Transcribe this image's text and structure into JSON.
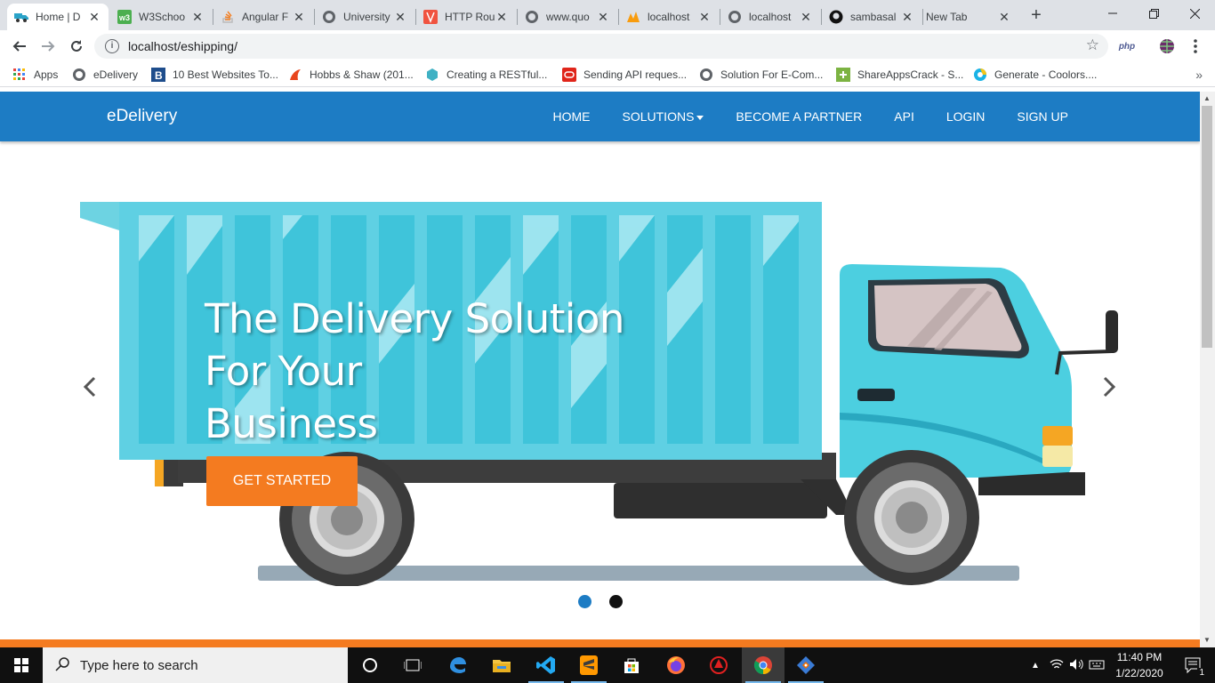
{
  "browser": {
    "tabs": [
      {
        "title": "Home | D",
        "icon": "truck-favicon",
        "active": true
      },
      {
        "title": "W3Schoo",
        "icon": "w3schools-favicon"
      },
      {
        "title": "Angular F",
        "icon": "stackoverflow-favicon"
      },
      {
        "title": "University",
        "icon": "globe-favicon"
      },
      {
        "title": "HTTP Rou",
        "icon": "laravel-favicon"
      },
      {
        "title": "www.quo",
        "icon": "globe-favicon"
      },
      {
        "title": "localhost",
        "icon": "phpmyadmin-favicon"
      },
      {
        "title": "localhost",
        "icon": "globe-favicon"
      },
      {
        "title": "sambasal",
        "icon": "github-favicon"
      },
      {
        "title": "New Tab",
        "icon": "none"
      }
    ],
    "url": "localhost/eshipping/",
    "php_extension_label": "php",
    "bookmarks": [
      {
        "label": "Apps",
        "icon": "apps-grid-icon"
      },
      {
        "label": "eDelivery",
        "icon": "globe-icon"
      },
      {
        "label": "10 Best Websites To...",
        "icon": "b-logo-icon"
      },
      {
        "label": "Hobbs & Shaw (201...",
        "icon": "hobbs-icon"
      },
      {
        "label": "Creating a RESTful...",
        "icon": "hexagon-icon"
      },
      {
        "label": "Sending API reques...",
        "icon": "oracle-icon"
      },
      {
        "label": "Solution For E-Com...",
        "icon": "globe-icon"
      },
      {
        "label": "ShareAppsCrack - S...",
        "icon": "share-icon"
      },
      {
        "label": "Generate - Coolors....",
        "icon": "coolors-icon"
      }
    ]
  },
  "site": {
    "brand": "eDelivery",
    "nav": [
      "HOME",
      "SOLUTIONS",
      "BECOME A PARTNER",
      "API",
      "LOGIN",
      "SIGN UP"
    ],
    "hero": {
      "headline_lines": [
        "The Delivery Solution",
        "For Your",
        "Business"
      ],
      "cta": "GET STARTED",
      "slides_total": 2,
      "slide_active": 1
    },
    "colors": {
      "navbar": "#1d7cc4",
      "accent": "#f47b20",
      "truck": "#4ecfe0"
    }
  },
  "taskbar": {
    "search_placeholder": "Type here to search",
    "time": "11:40 PM",
    "date": "1/22/2020",
    "notification_count": "1",
    "apps": [
      "cortana",
      "task-view",
      "edge",
      "file-explorer",
      "vscode",
      "sublime-text",
      "store",
      "firefox",
      "app-red",
      "chrome",
      "git"
    ]
  }
}
